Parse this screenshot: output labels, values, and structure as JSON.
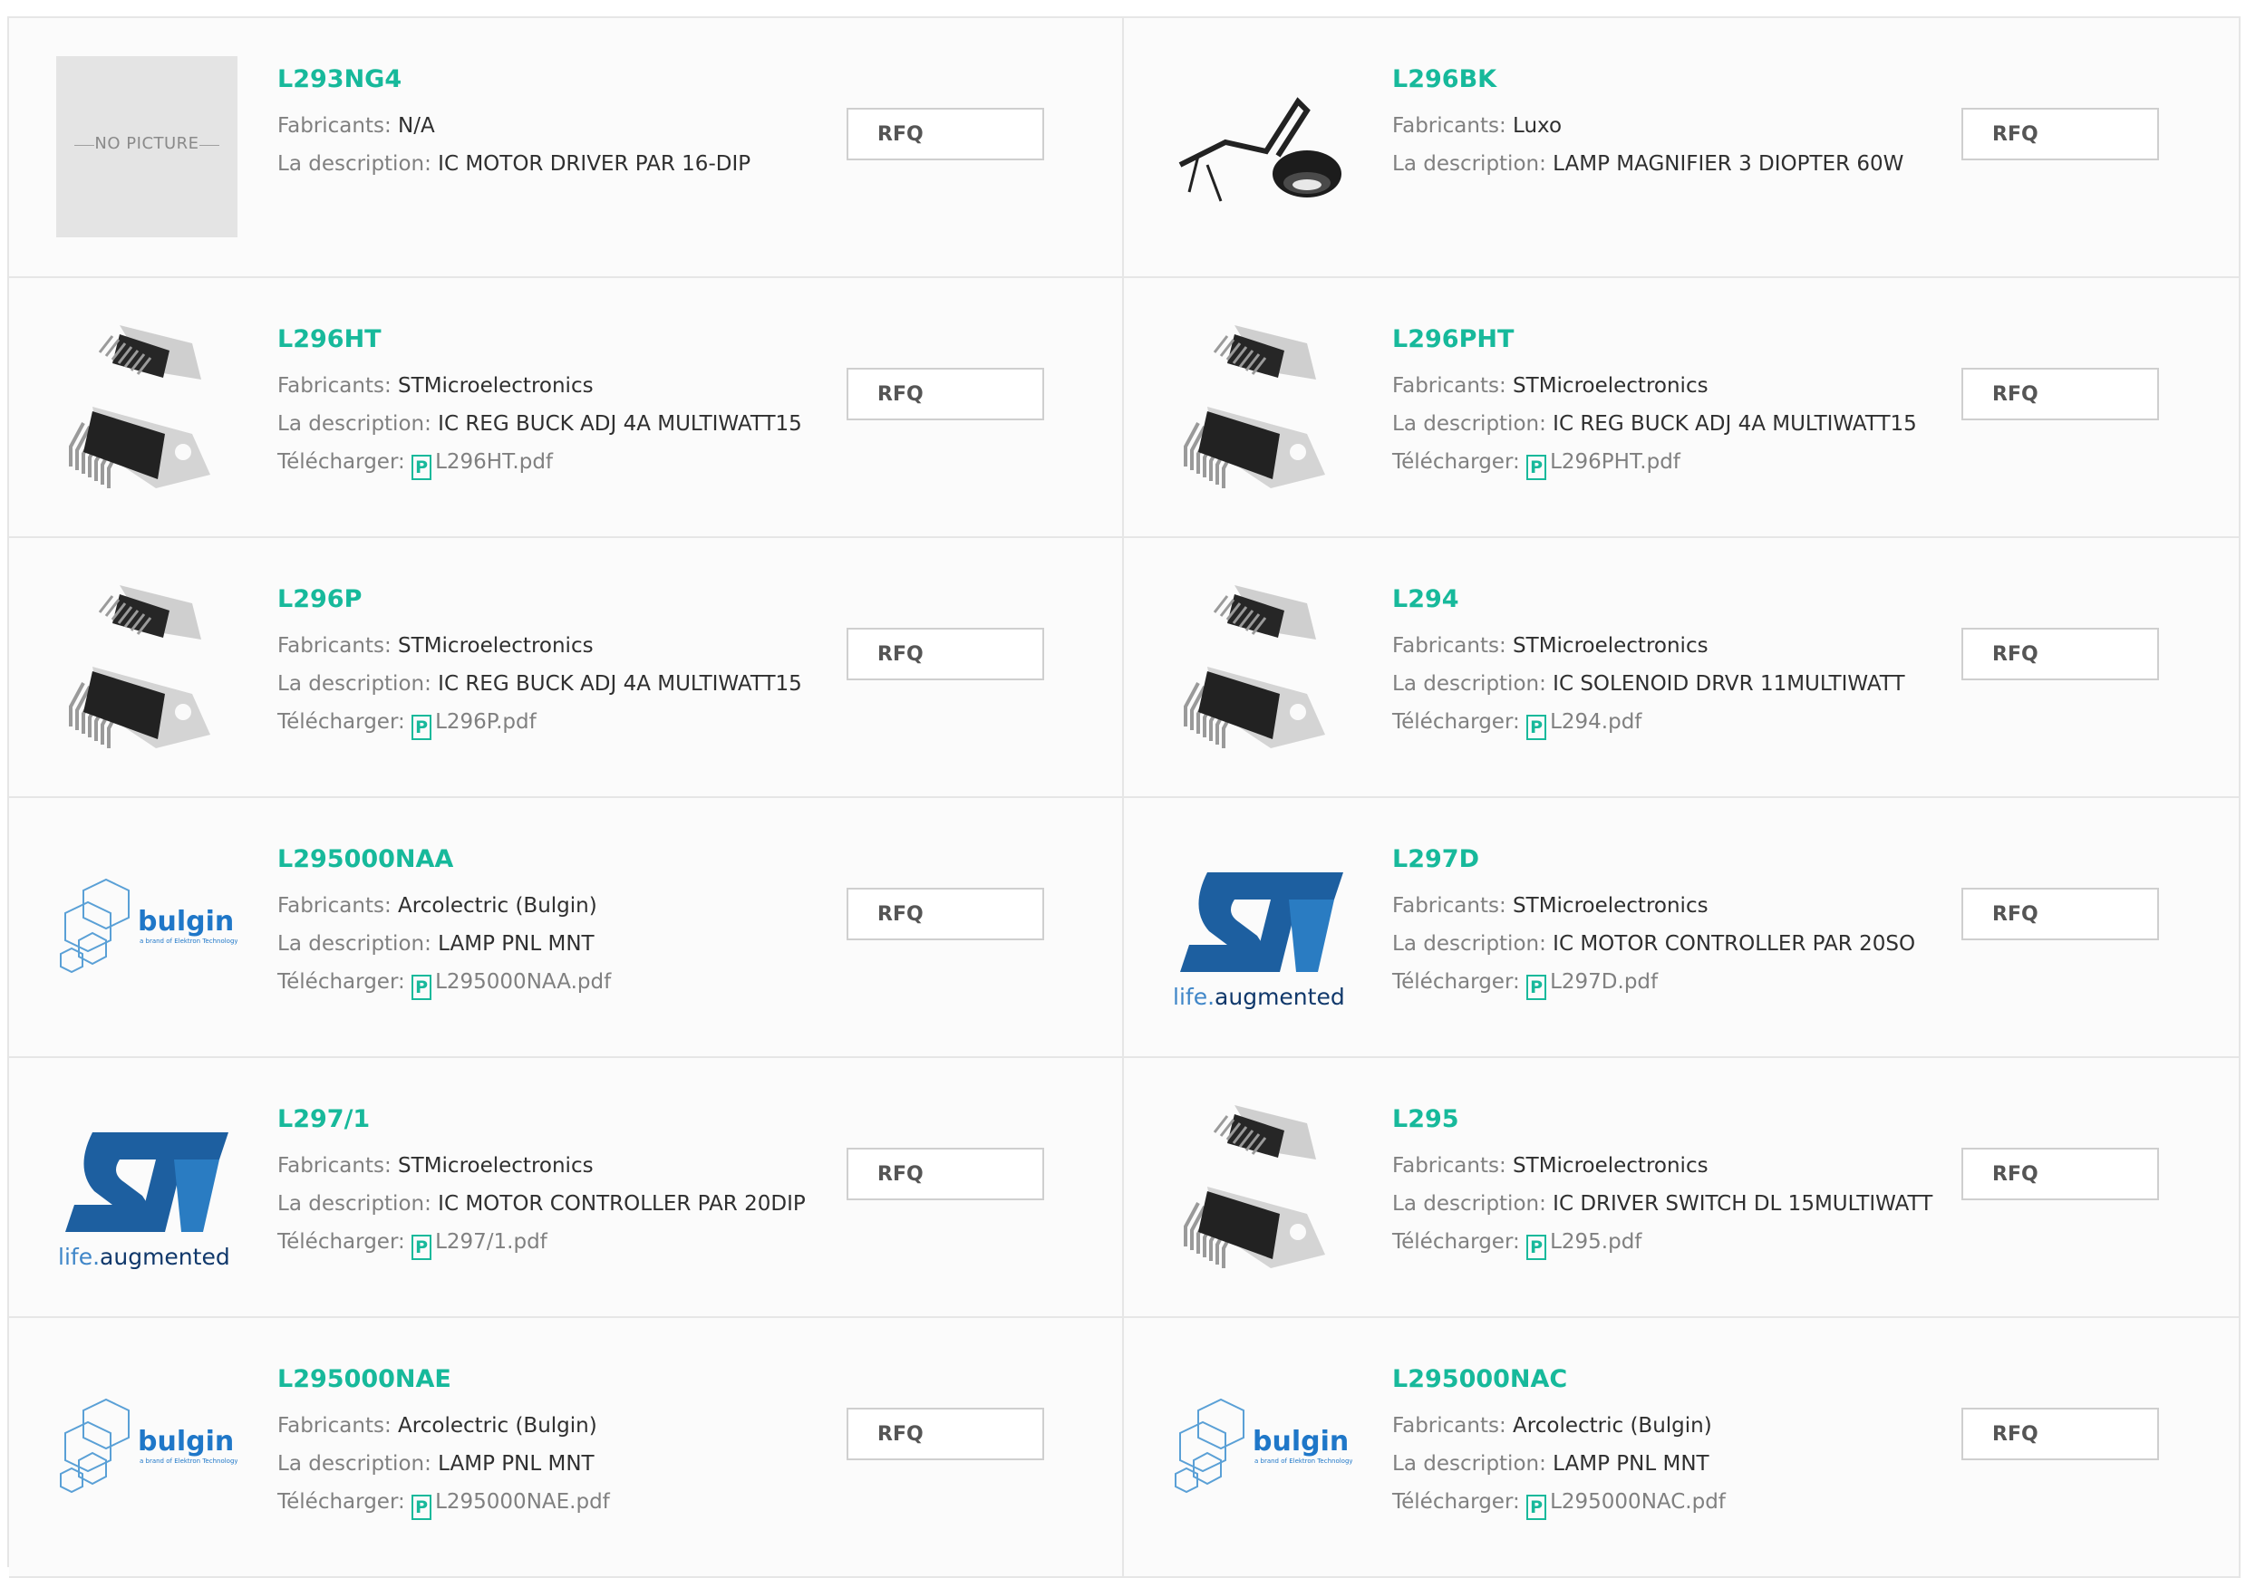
{
  "labels": {
    "manufacturer": "Fabricants:",
    "description": "La description:",
    "download": "Télécharger:",
    "rfq": "RFQ",
    "pdf_glyph": "P",
    "no_picture": "NO PICTURE"
  },
  "brands": {
    "bulgin": "bulgin",
    "bulgin_tagline": "a brand of Elektron Technology",
    "st_tagline_a": "life.",
    "st_tagline_b": "augmented"
  },
  "colors": {
    "accent": "#17b99b",
    "st_blue": "#1d5fa0",
    "bulgin_blue": "#1f77c8"
  },
  "products": [
    {
      "part": "L293NG4",
      "manufacturer": "N/A",
      "description": "IC MOTOR DRIVER PAR 16-DIP",
      "datasheet": "",
      "image": "no-picture"
    },
    {
      "part": "L296BK",
      "manufacturer": "Luxo",
      "description": "LAMP MAGNIFIER 3 DIOPTER 60W",
      "datasheet": "",
      "image": "lamp"
    },
    {
      "part": "L296HT",
      "manufacturer": "STMicroelectronics",
      "description": "IC REG BUCK ADJ 4A MULTIWATT15",
      "datasheet": "L296HT.pdf",
      "image": "multiwatt"
    },
    {
      "part": "L296PHT",
      "manufacturer": "STMicroelectronics",
      "description": "IC REG BUCK ADJ 4A MULTIWATT15",
      "datasheet": "L296PHT.pdf",
      "image": "multiwatt"
    },
    {
      "part": "L296P",
      "manufacturer": "STMicroelectronics",
      "description": "IC REG BUCK ADJ 4A MULTIWATT15",
      "datasheet": "L296P.pdf",
      "image": "multiwatt"
    },
    {
      "part": "L294",
      "manufacturer": "STMicroelectronics",
      "description": "IC SOLENOID DRVR 11MULTIWATT",
      "datasheet": "L294.pdf",
      "image": "multiwatt"
    },
    {
      "part": "L295000NAA",
      "manufacturer": "Arcolectric (Bulgin)",
      "description": "LAMP PNL MNT",
      "datasheet": "L295000NAA.pdf",
      "image": "bulgin-logo"
    },
    {
      "part": "L297D",
      "manufacturer": "STMicroelectronics",
      "description": "IC MOTOR CONTROLLER PAR 20SO",
      "datasheet": "L297D.pdf",
      "image": "st-logo"
    },
    {
      "part": "L297/1",
      "manufacturer": "STMicroelectronics",
      "description": "IC MOTOR CONTROLLER PAR 20DIP",
      "datasheet": "L297/1.pdf",
      "image": "st-logo"
    },
    {
      "part": "L295",
      "manufacturer": "STMicroelectronics",
      "description": "IC DRIVER SWITCH DL 15MULTIWATT",
      "datasheet": "L295.pdf",
      "image": "multiwatt"
    },
    {
      "part": "L295000NAE",
      "manufacturer": "Arcolectric (Bulgin)",
      "description": "LAMP PNL MNT",
      "datasheet": "L295000NAE.pdf",
      "image": "bulgin-logo"
    },
    {
      "part": "L295000NAC",
      "manufacturer": "Arcolectric (Bulgin)",
      "description": "LAMP PNL MNT",
      "datasheet": "L295000NAC.pdf",
      "image": "bulgin-logo"
    }
  ]
}
